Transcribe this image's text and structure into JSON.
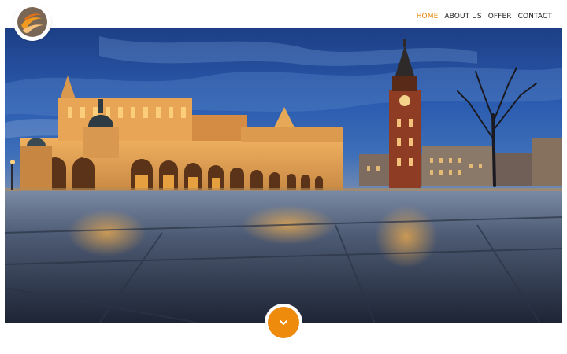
{
  "logo": {
    "icon": "brand-swirl-logo"
  },
  "nav": {
    "items": [
      {
        "label": "HOME",
        "active": true
      },
      {
        "label": "ABOUT US",
        "active": false
      },
      {
        "label": "OFFER",
        "active": false
      },
      {
        "label": "CONTACT",
        "active": false
      }
    ]
  },
  "hero": {
    "icon": "market-square-night-photo"
  },
  "scroll": {
    "icon": "chevron-down-icon"
  },
  "colors": {
    "accent": "#ee8a0c",
    "text": "#222222",
    "background": "#ffffff"
  }
}
